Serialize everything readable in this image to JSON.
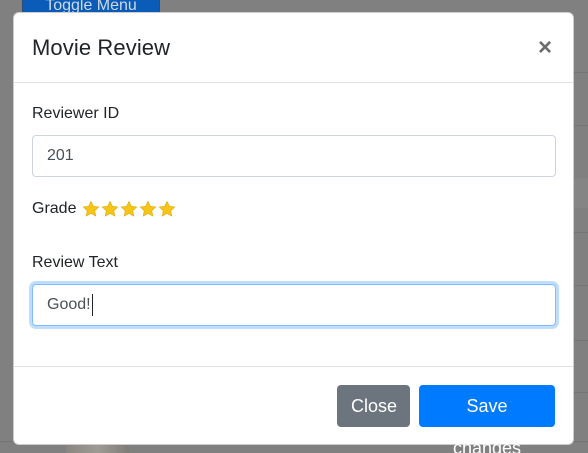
{
  "background": {
    "toggle_button_label": "Toggle Menu"
  },
  "modal": {
    "title": "Movie Review",
    "close_symbol": "×",
    "reviewer_id": {
      "label": "Reviewer ID",
      "value": "201"
    },
    "grade": {
      "label": "Grade",
      "stars_filled": 5,
      "stars_total": 5,
      "star_color": "#f5c518"
    },
    "review_text": {
      "label": "Review Text",
      "value": "Good!"
    },
    "footer": {
      "close_label": "Close",
      "save_label": "Save changes"
    }
  },
  "colors": {
    "primary": "#007bff",
    "secondary": "#6c757d",
    "focus_border": "#80bdff"
  }
}
